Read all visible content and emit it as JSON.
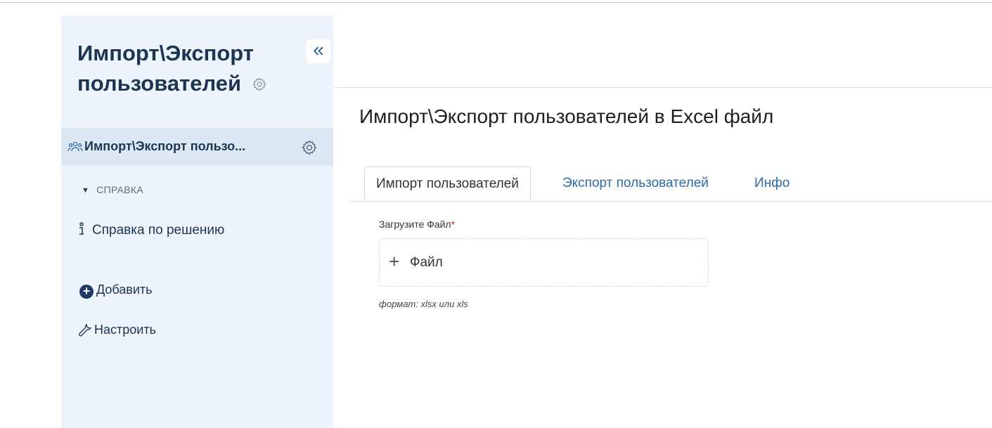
{
  "sidebar": {
    "title": "Импорт\\Экспорт пользователей",
    "collapse_label": "«",
    "active_item": "Импорт\\Экспорт пользо...",
    "section_title": "СПРАВКА",
    "help_item": "Справка по решению",
    "add_label": "Добавить",
    "setup_label": "Настроить"
  },
  "main": {
    "title": "Импорт\\Экспорт пользователей в Excel файл",
    "tabs": [
      {
        "label": "Импорт пользователей",
        "active": true
      },
      {
        "label": "Экспорт пользователей",
        "active": false
      },
      {
        "label": "Инфо",
        "active": false
      }
    ],
    "upload": {
      "label": "Загрузите Файл",
      "required_mark": "*",
      "button_label": "Файл",
      "hint": "формат: xlsx или xls"
    }
  },
  "colors": {
    "sidebar_bg": "#edf4fc",
    "active_bg": "#dde8f5",
    "link": "#2d6aa8",
    "dark_text": "#1d3552"
  }
}
